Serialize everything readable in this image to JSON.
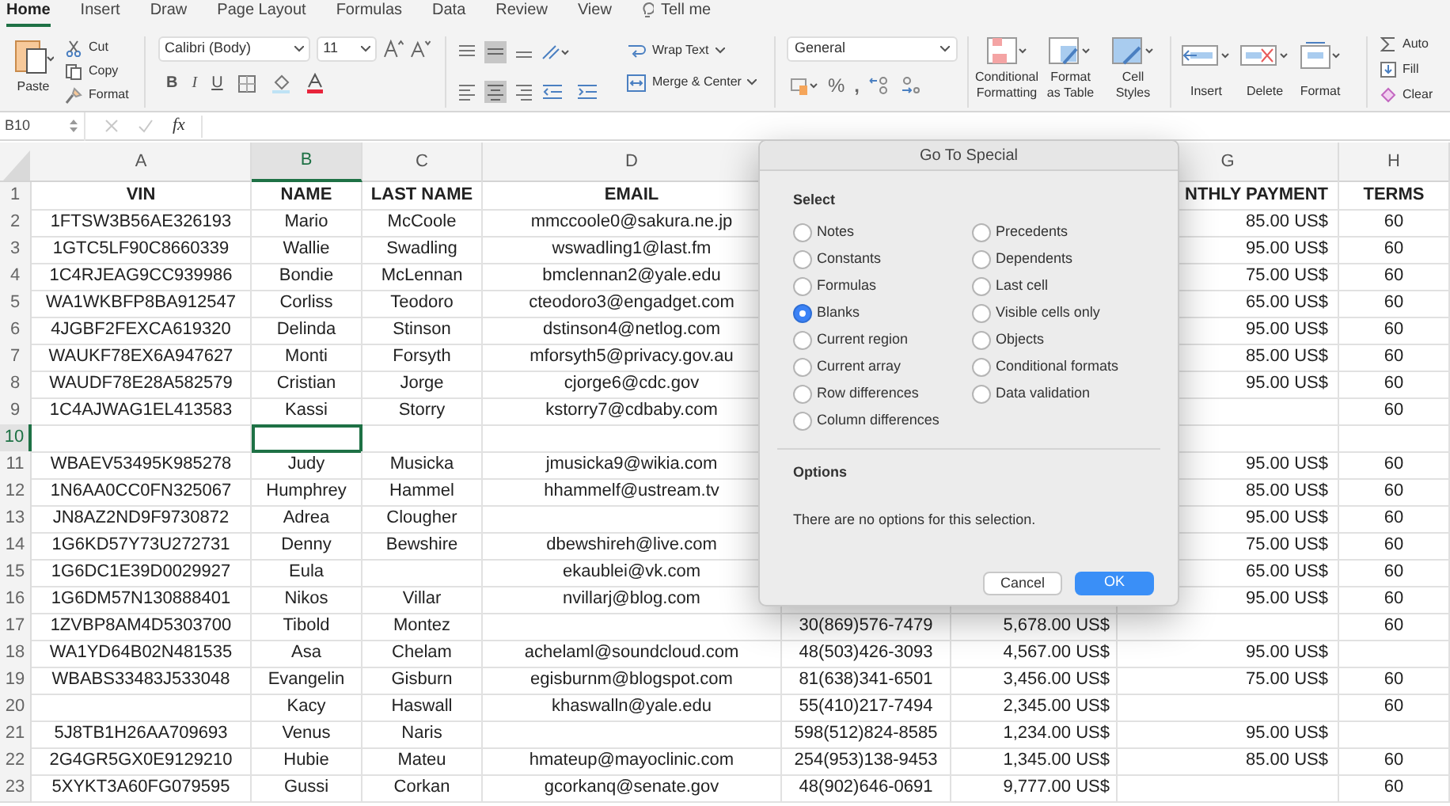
{
  "menu_tabs": [
    {
      "label": "Home",
      "selected": true
    },
    {
      "label": "Insert",
      "selected": false
    },
    {
      "label": "Draw",
      "selected": false
    },
    {
      "label": "Page Layout",
      "selected": false
    },
    {
      "label": "Formulas",
      "selected": false
    },
    {
      "label": "Data",
      "selected": false
    },
    {
      "label": "Review",
      "selected": false
    },
    {
      "label": "View",
      "selected": false
    }
  ],
  "tell_me": "Tell me",
  "ribbon": {
    "paste": "Paste",
    "cut": "Cut",
    "copy": "Copy",
    "format_painter": "Format",
    "font": "Calibri (Body)",
    "font_size": "11",
    "bold": "B",
    "italic": "I",
    "underline": "U",
    "wrap_text": "Wrap Text",
    "merge": "Merge & Center",
    "number_format": "General",
    "percent": "%",
    "comma": ",",
    "styles": [
      {
        "lines": [
          "Conditional",
          "Formatting"
        ],
        "kind": "conditional"
      },
      {
        "lines": [
          "Format",
          "as Table"
        ],
        "kind": "table"
      },
      {
        "lines": [
          "Cell",
          "Styles"
        ],
        "kind": "styles"
      }
    ],
    "cells": [
      {
        "label": "Insert",
        "kind": "insert"
      },
      {
        "label": "Delete",
        "kind": "delete"
      },
      {
        "label": "Format",
        "kind": "format"
      }
    ],
    "editing": [
      {
        "label": "Auto",
        "kind": "sum"
      },
      {
        "label": "Fill",
        "kind": "fill"
      },
      {
        "label": "Clear",
        "kind": "clear"
      }
    ]
  },
  "formula_bar": {
    "name_box": "B10",
    "fx": "fx"
  },
  "columns": [
    {
      "letter": "A",
      "selected": false
    },
    {
      "letter": "B",
      "selected": true
    },
    {
      "letter": "C",
      "selected": false
    },
    {
      "letter": "D",
      "selected": false
    },
    {
      "letter": "G",
      "selected": false
    },
    {
      "letter": "H",
      "selected": false
    }
  ],
  "rows": [
    {
      "number": "1",
      "kind": "header",
      "selected": false,
      "cells": [
        "VIN",
        "NAME",
        "LAST NAME",
        "EMAIL",
        null,
        null,
        "NTHLY PAYMENT",
        "TERMS"
      ]
    },
    {
      "number": "2",
      "kind": "data",
      "selected": false,
      "cells": [
        "1FTSW3B56AE326193",
        "Mario",
        "McCoole",
        "mmccoole0@sakura.ne.jp",
        null,
        null,
        "85.00 US$",
        "60"
      ]
    },
    {
      "number": "3",
      "kind": "data",
      "selected": false,
      "cells": [
        "1GTC5LF90C8660339",
        "Wallie",
        "Swadling",
        "wswadling1@last.fm",
        null,
        null,
        "95.00 US$",
        "60"
      ]
    },
    {
      "number": "4",
      "kind": "data",
      "selected": false,
      "cells": [
        "1C4RJEAG9CC939986",
        "Bondie",
        "McLennan",
        "bmclennan2@yale.edu",
        null,
        null,
        "75.00 US$",
        "60"
      ]
    },
    {
      "number": "5",
      "kind": "data",
      "selected": false,
      "cells": [
        "WA1WKBFP8BA912547",
        "Corliss",
        "Teodoro",
        "cteodoro3@engadget.com",
        null,
        null,
        "65.00 US$",
        "60"
      ]
    },
    {
      "number": "6",
      "kind": "data",
      "selected": false,
      "cells": [
        "4JGBF2FEXCA619320",
        "Delinda",
        "Stinson",
        "dstinson4@netlog.com",
        null,
        null,
        "95.00 US$",
        "60"
      ]
    },
    {
      "number": "7",
      "kind": "data",
      "selected": false,
      "cells": [
        "WAUKF78EX6A947627",
        "Monti",
        "Forsyth",
        "mforsyth5@privacy.gov.au",
        null,
        null,
        "85.00 US$",
        "60"
      ]
    },
    {
      "number": "8",
      "kind": "data",
      "selected": false,
      "cells": [
        "WAUDF78E28A582579",
        "Cristian",
        "Jorge",
        "cjorge6@cdc.gov",
        null,
        null,
        "95.00 US$",
        "60"
      ]
    },
    {
      "number": "9",
      "kind": "data",
      "selected": false,
      "cells": [
        "1C4AJWAG1EL413583",
        "Kassi",
        "Storry",
        "kstorry7@cdbaby.com",
        null,
        null,
        null,
        "60"
      ]
    },
    {
      "number": "10",
      "kind": "data",
      "selected": true,
      "cells": [
        null,
        null,
        null,
        null,
        null,
        null,
        null,
        null
      ]
    },
    {
      "number": "11",
      "kind": "data",
      "selected": false,
      "cells": [
        "WBAEV53495K985278",
        "Judy",
        "Musicka",
        "jmusicka9@wikia.com",
        null,
        null,
        "95.00 US$",
        "60"
      ]
    },
    {
      "number": "12",
      "kind": "data",
      "selected": false,
      "cells": [
        "1N6AA0CC0FN325067",
        "Humphrey",
        "Hammel",
        "hhammelf@ustream.tv",
        null,
        null,
        "85.00 US$",
        "60"
      ]
    },
    {
      "number": "13",
      "kind": "data",
      "selected": false,
      "cells": [
        "JN8AZ2ND9F9730872",
        "Adrea",
        "Clougher",
        null,
        null,
        null,
        "95.00 US$",
        "60"
      ]
    },
    {
      "number": "14",
      "kind": "data",
      "selected": false,
      "cells": [
        "1G6KD57Y73U272731",
        "Denny",
        "Bewshire",
        "dbewshireh@live.com",
        null,
        null,
        "75.00 US$",
        "60"
      ]
    },
    {
      "number": "15",
      "kind": "data",
      "selected": false,
      "cells": [
        "1G6DC1E39D0029927",
        "Eula",
        null,
        "ekaublei@vk.com",
        null,
        null,
        "65.00 US$",
        "60"
      ]
    },
    {
      "number": "16",
      "kind": "data",
      "selected": false,
      "cells": [
        "1G6DM57N130888401",
        "Nikos",
        "Villar",
        "nvillarj@blog.com",
        null,
        null,
        "95.00 US$",
        "60"
      ]
    },
    {
      "number": "17",
      "kind": "data",
      "selected": false,
      "cells": [
        "1ZVBP8AM4D5303700",
        "Tibold",
        "Montez",
        null,
        "30(869)576-7479",
        "5,678.00 US$",
        null,
        "60"
      ]
    },
    {
      "number": "18",
      "kind": "data",
      "selected": false,
      "cells": [
        "WA1YD64B02N481535",
        "Asa",
        "Chelam",
        "achelaml@soundcloud.com",
        "48(503)426-3093",
        "4,567.00 US$",
        "95.00 US$",
        null
      ]
    },
    {
      "number": "19",
      "kind": "data",
      "selected": false,
      "cells": [
        "WBABS33483J533048",
        "Evangelin",
        "Gisburn",
        "egisburnm@blogspot.com",
        "81(638)341-6501",
        "3,456.00 US$",
        "75.00 US$",
        "60"
      ]
    },
    {
      "number": "20",
      "kind": "data",
      "selected": false,
      "cells": [
        null,
        "Kacy",
        "Haswall",
        "khaswalln@yale.edu",
        "55(410)217-7494",
        "2,345.00 US$",
        null,
        "60"
      ]
    },
    {
      "number": "21",
      "kind": "data",
      "selected": false,
      "cells": [
        "5J8TB1H26AA709693",
        "Venus",
        "Naris",
        null,
        "598(512)824-8585",
        "1,234.00 US$",
        "95.00 US$",
        null
      ]
    },
    {
      "number": "22",
      "kind": "data",
      "selected": false,
      "cells": [
        "2G4GR5GX0E9129210",
        "Hubie",
        "Mateu",
        "hmateup@mayoclinic.com",
        "254(953)138-9453",
        "1,345.00 US$",
        "85.00 US$",
        "60"
      ]
    },
    {
      "number": "23",
      "kind": "data",
      "selected": false,
      "cells": [
        "5XYKT3A60FG079595",
        "Gussi",
        "Corkan",
        "gcorkanq@senate.gov",
        "48(902)646-0691",
        "9,777.00 US$",
        null,
        "60"
      ]
    }
  ],
  "dialog": {
    "title": "Go To Special",
    "section": "Select",
    "columns": [
      [
        {
          "label": "Notes",
          "selected": false
        },
        {
          "label": "Constants",
          "selected": false
        },
        {
          "label": "Formulas",
          "selected": false
        },
        {
          "label": "Blanks",
          "selected": true
        },
        {
          "label": "Current region",
          "selected": false
        },
        {
          "label": "Current array",
          "selected": false
        },
        {
          "label": "Row differences",
          "selected": false
        },
        {
          "label": "Column differences",
          "selected": false
        }
      ],
      [
        {
          "label": "Precedents",
          "selected": false
        },
        {
          "label": "Dependents",
          "selected": false
        },
        {
          "label": "Last cell",
          "selected": false
        },
        {
          "label": "Visible cells only",
          "selected": false
        },
        {
          "label": "Objects",
          "selected": false
        },
        {
          "label": "Conditional formats",
          "selected": false
        },
        {
          "label": "Data validation",
          "selected": false
        }
      ]
    ],
    "options_heading": "Options",
    "message": "There are no options for this selection.",
    "buttons": [
      {
        "label": "Cancel",
        "kind": "secondary"
      },
      {
        "label": "OK",
        "kind": "primary"
      }
    ]
  }
}
